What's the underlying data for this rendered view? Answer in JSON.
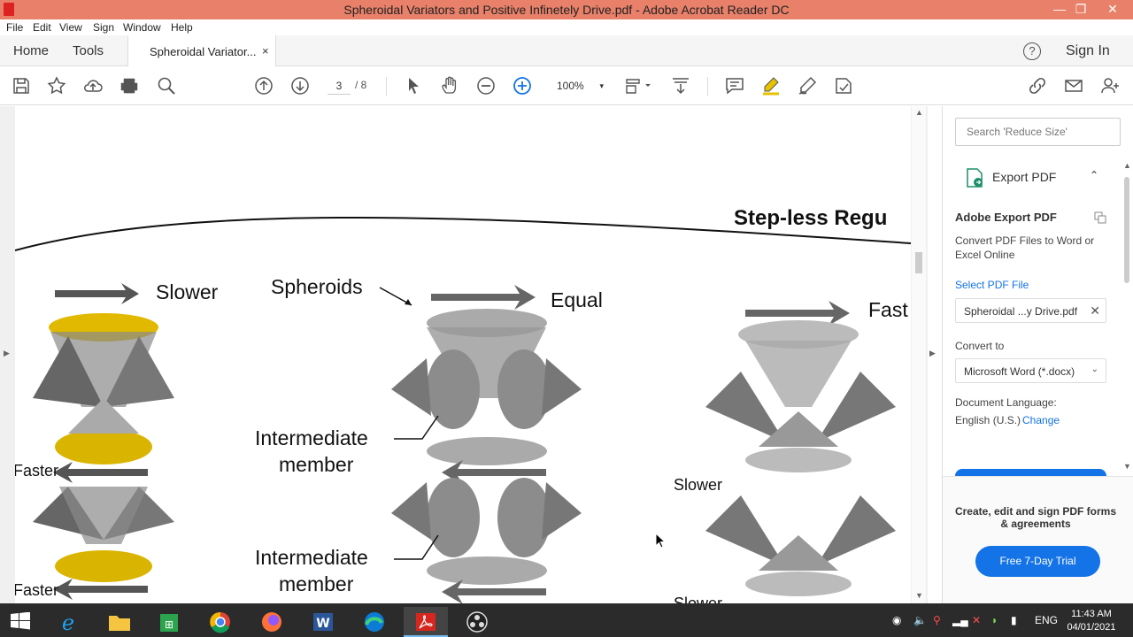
{
  "window": {
    "title": "Spheroidal Variators and Positive Infinetely Drive.pdf - Adobe Acrobat Reader DC",
    "controls": {
      "minimize": "—",
      "restore": "❐",
      "close": "✕"
    }
  },
  "menu": [
    "File",
    "Edit",
    "View",
    "Sign",
    "Window",
    "Help"
  ],
  "tabs": {
    "home": "Home",
    "tools": "Tools",
    "doc_tab": "Spheroidal Variator...",
    "close": "×",
    "help": "?",
    "sign_in": "Sign In"
  },
  "toolbar": {
    "page_current": "3",
    "page_total": "/ 8",
    "zoom": "100%",
    "zoom_caret": "▾"
  },
  "document": {
    "heading_partial": "Step-less Regu",
    "labels": {
      "slower_left": "Slower",
      "spheroids": "Spheroids",
      "equal": "Equal",
      "faster_right": "Fast",
      "intermediate_1a": "Intermediate",
      "intermediate_1b": "member",
      "intermediate_2a": "Intermediate",
      "intermediate_2b": "member",
      "faster_left_1": "Faster",
      "faster_left_2": "Faster",
      "slower_right_1": "Slower",
      "slower_right_2": "Slower"
    }
  },
  "right_panel": {
    "search_placeholder": "Search 'Reduce Size'",
    "export_title": "Export PDF",
    "chevron": "⌃",
    "section_title": "Adobe Export PDF",
    "description": "Convert PDF Files to Word or Excel Online",
    "select_file_label": "Select PDF File",
    "selected_file": "Spheroidal ...y Drive.pdf",
    "remove_file": "✕",
    "convert_to_label": "Convert to",
    "convert_to_value": "Microsoft Word (*.docx)",
    "dropdown_caret": "⌄",
    "doc_language_label": "Document Language:",
    "doc_language_value": "English (U.S.)",
    "change_link": "Change",
    "promo_text": "Create, edit and sign PDF forms & agreements",
    "trial_button": "Free 7-Day Trial"
  },
  "taskbar": {
    "language": "ENG",
    "time": "11:43 AM",
    "date": "04/01/2021"
  },
  "colors": {
    "titlebar": "#e8806a",
    "accent_blue": "#1473e6",
    "taskbar": "#2b2b2b",
    "highlight_yellow": "#e6c200"
  }
}
